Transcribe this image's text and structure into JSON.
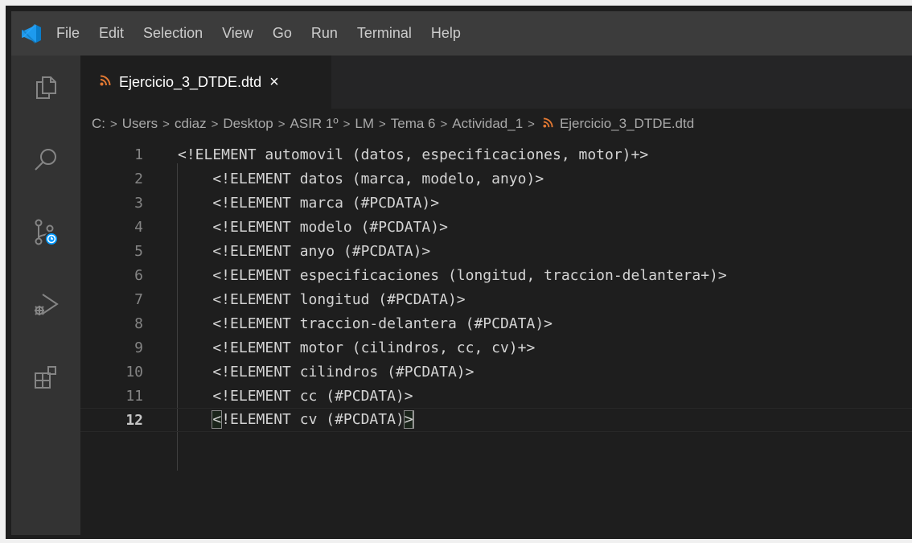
{
  "menu": [
    "File",
    "Edit",
    "Selection",
    "View",
    "Go",
    "Run",
    "Terminal",
    "Help"
  ],
  "tab": {
    "label": "Ejercicio_3_DTDE.dtd",
    "close": "×"
  },
  "breadcrumb": [
    "C:",
    "Users",
    "cdiaz",
    "Desktop",
    "ASIR 1º",
    "LM",
    "Tema 6",
    "Actividad_1",
    "Ejercicio_3_DTDE.dtd"
  ],
  "lines": [
    {
      "num": "1",
      "text": "<!ELEMENT automovil (datos, especificaciones, motor)+>"
    },
    {
      "num": "2",
      "text": "    <!ELEMENT datos (marca, modelo, anyo)>"
    },
    {
      "num": "3",
      "text": "    <!ELEMENT marca (#PCDATA)>"
    },
    {
      "num": "4",
      "text": "    <!ELEMENT modelo (#PCDATA)>"
    },
    {
      "num": "5",
      "text": "    <!ELEMENT anyo (#PCDATA)>"
    },
    {
      "num": "6",
      "text": "    <!ELEMENT especificaciones (longitud, traccion-delantera+)>"
    },
    {
      "num": "7",
      "text": "    <!ELEMENT longitud (#PCDATA)>"
    },
    {
      "num": "8",
      "text": "    <!ELEMENT traccion-delantera (#PCDATA)>"
    },
    {
      "num": "9",
      "text": "    <!ELEMENT motor (cilindros, cc, cv)+>"
    },
    {
      "num": "10",
      "text": "    <!ELEMENT cilindros (#PCDATA)>"
    },
    {
      "num": "11",
      "text": "    <!ELEMENT cc (#PCDATA)>"
    }
  ],
  "current_line": {
    "num": "12",
    "indent": "    ",
    "open": "<",
    "middle": "!ELEMENT cv (#PCDATA)",
    "close": ">"
  },
  "colors": {
    "accent_blue": "#0098ff",
    "rss_orange": "#e37933"
  }
}
